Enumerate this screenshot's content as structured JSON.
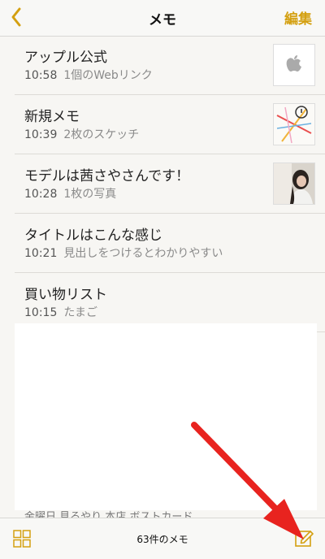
{
  "nav": {
    "title": "メモ",
    "edit_label": "編集"
  },
  "notes": [
    {
      "title": "アップル公式",
      "time": "10:58",
      "preview": "1個のWebリンク",
      "thumb": "apple-logo"
    },
    {
      "title": "新規メモ",
      "time": "10:39",
      "preview": "2枚のスケッチ",
      "thumb": "sketch"
    },
    {
      "title": "モデルは茜さやさんです！",
      "time": "10:28",
      "preview": "1枚の写真",
      "thumb": "photo"
    },
    {
      "title": "タイトルはこんな感じ",
      "time": "10:21",
      "preview": "見出しをつけるとわかりやすい"
    },
    {
      "title": "買い物リスト",
      "time": "10:15",
      "preview": "たまご"
    }
  ],
  "toolbar": {
    "count_label": "63件のメモ"
  },
  "partial_text": "金曜日 見るやり 本店 ボストカード",
  "colors": {
    "accent": "#d4a011",
    "annotation_arrow": "#e8231f"
  }
}
